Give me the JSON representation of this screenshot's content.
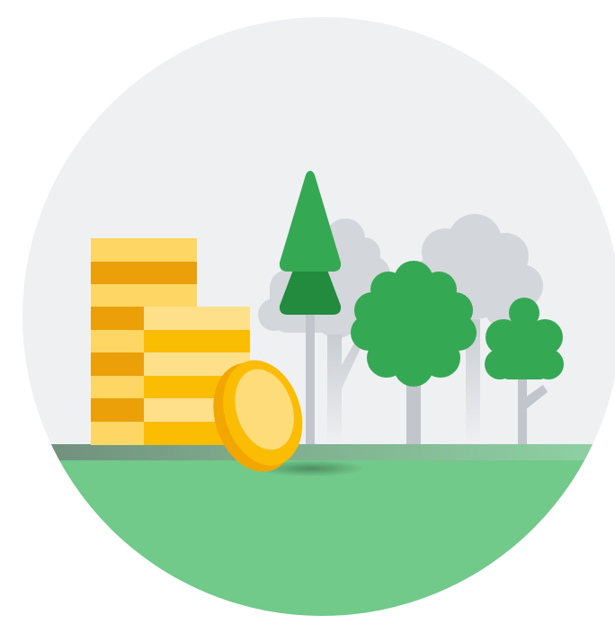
{
  "illustration": {
    "subject": "coins-and-trees",
    "colors": {
      "sky": "#eef0f2",
      "ground": "#71c98a",
      "ground_edge": "#8fc9a0",
      "tree_green": "#35a853",
      "tree_dark": "#228b3e",
      "tree_ghost": "#d3d6db",
      "trunk": "#c2c5cb",
      "coin_gold": "#fbbc04",
      "coin_light": "#fdd663",
      "coin_pale": "#fee08b",
      "coin_dark": "#eba00a"
    }
  }
}
